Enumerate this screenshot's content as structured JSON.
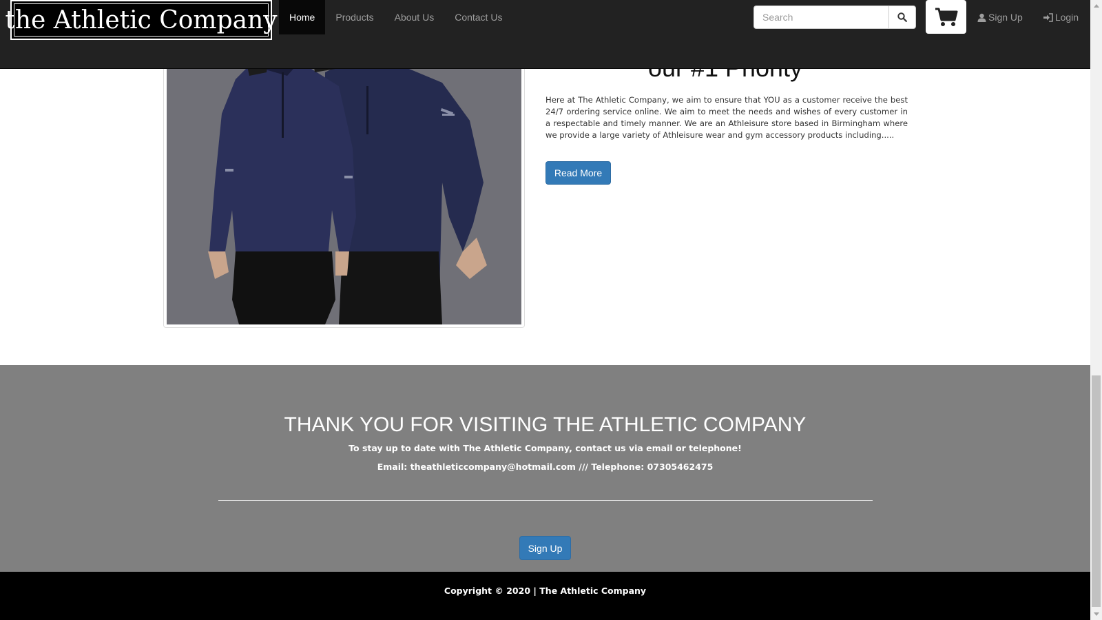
{
  "navbar": {
    "logo_text": "the Athletic Company",
    "links": [
      {
        "label": "Home",
        "active": true
      },
      {
        "label": "Products",
        "active": false
      },
      {
        "label": "About Us",
        "active": false
      },
      {
        "label": "Contact Us",
        "active": false
      }
    ],
    "search_placeholder": "Search",
    "search_icon": "search-icon",
    "cart_icon": "shopping-cart-icon",
    "signup_label": "Sign Up",
    "signup_icon": "user-icon",
    "login_label": "Login",
    "login_icon": "log-in-icon"
  },
  "main": {
    "heading_partial": "our #1 Priority",
    "about_text": "Here at The Athletic Company, we aim to ensure that YOU as a customer receive the best 24/7 ordering service online. We aim to meet the needs and wishes of every customer in a respectable and timely manner. We are an Athleisure store based in Birmingham where we provide a large variety of Athleisure wear and gym accessory products including.....",
    "read_more_label": "Read More"
  },
  "footer": {
    "title": "THANK YOU FOR VISITING THE ATHLETIC COMPANY",
    "subtitle": "To stay up to date with The Athletic Company, contact us via email or telephone!",
    "contact_line": "Email: theathleticcompany@hotmail.com /// Telephone: 07305462475",
    "signup_label": "Sign Up",
    "copyright": "Copyright © 2020 | The Athletic Company"
  },
  "colors": {
    "navbar_bg": "#222222",
    "button_primary": "#337ab7",
    "footer_bg": "#808080",
    "copyright_bg": "#000000"
  }
}
